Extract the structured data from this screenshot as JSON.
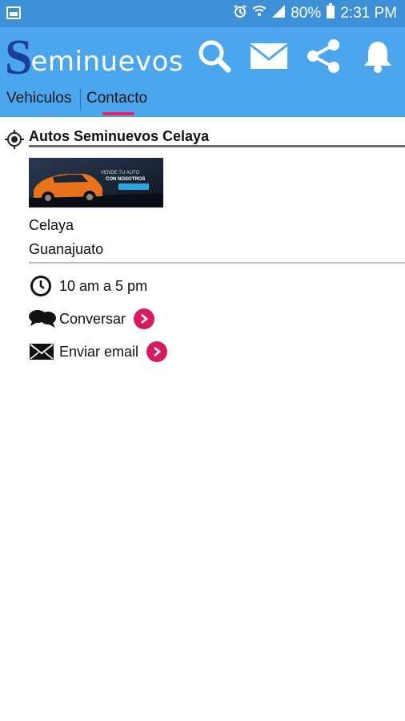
{
  "status_bar": {
    "battery": "80%",
    "time": "2:31 PM"
  },
  "app": {
    "logo_initial": "S",
    "logo_rest": "eminuevos"
  },
  "tabs": [
    {
      "label": "Vehiculos",
      "selected": false
    },
    {
      "label": "Contacto",
      "selected": true
    }
  ],
  "contact": {
    "name": "Autos Seminuevos Celaya",
    "city": "Celaya",
    "state": "Guanajuato",
    "hours": "10 am a 5 pm",
    "chat_label": "Conversar",
    "email_label": "Enviar email",
    "banner_line1": "VENDE TU AUTO",
    "banner_line2": "CON NOSOTROS"
  },
  "colors": {
    "status_bar": "#3d8fd6",
    "app_bar": "#4ba6ee",
    "accent": "#e91e63"
  }
}
